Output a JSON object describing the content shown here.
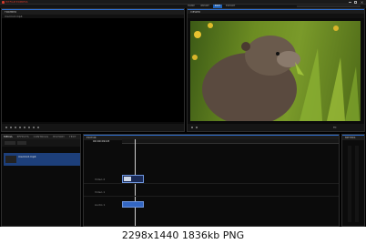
{
  "app": {
    "logo_text": "HITFILM EXPRESS",
    "window_buttons": [
      "minimize-icon",
      "maximize-icon",
      "close-icon"
    ]
  },
  "menu": {
    "tabs": [
      {
        "label": "HOME",
        "active": false
      },
      {
        "label": "IMPORT",
        "active": false
      },
      {
        "label": "EDIT",
        "active": true
      },
      {
        "label": "EXPORT",
        "active": false
      }
    ]
  },
  "viewer_left": {
    "tab": "TRIMMER",
    "subtab": "marmot.mp4"
  },
  "viewer_right": {
    "tab": "VIEWER",
    "zoom": "Fit"
  },
  "panels": {
    "bottom_left_tabs": [
      "MEDIA",
      "EFFECTS",
      "CONTROLS",
      "HISTORY",
      "TEXT"
    ],
    "media_item": "marmot.mp4",
    "timeline_tab": "EDITOR",
    "timecode": "00:00:09:23",
    "meters_tab": "METERS"
  },
  "tracks": [
    {
      "label": "Video 2"
    },
    {
      "label": "Video 1"
    },
    {
      "label": "Audio 1"
    }
  ],
  "theme": {
    "accent": "#1e5fb3",
    "clip": "#3367c4"
  },
  "caption": "2298x1440  1836kb  PNG"
}
